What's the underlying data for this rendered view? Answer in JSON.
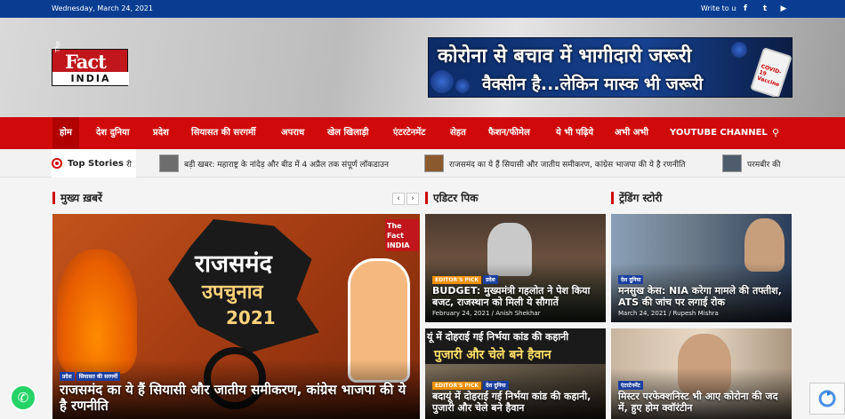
{
  "topbar": {
    "date": "Wednesday, March 24, 2021",
    "write_to_us": "Write to us",
    "social": [
      {
        "icon": "facebook-icon",
        "glyph": "f"
      },
      {
        "icon": "twitter-icon",
        "glyph": "t"
      },
      {
        "icon": "youtube-icon",
        "glyph": "▶"
      }
    ]
  },
  "logo": {
    "the": "The",
    "fact": "Fact",
    "india": "INDIA"
  },
  "banner": {
    "line1": "कोरोना से बचाव में भागीदारी जरूरी",
    "line2": "वैक्सीन है...लेकिन मास्क भी जरूरी",
    "vial_label": "COVID-19 Vaccine"
  },
  "nav": {
    "items": [
      "होम",
      "देश दुनिया",
      "प्रदेश",
      "सियासत की सरगर्मी",
      "अपराध",
      "खेल खिलाड़ी",
      "एंटरटेनमेंट",
      "सेहत",
      "फैशन/फीमेल",
      "ये भी पढ़िये",
      "अभी अभी",
      "YOUTUBE CHANNEL"
    ],
    "search_icon": "search-icon"
  },
  "ticker": {
    "label": "Top Stories",
    "items": [
      {
        "text": "री"
      },
      {
        "text": "बड़ी खबर: महाराष्ट्र के नांदेड़ और बीड में 4 अप्रैल तक संपूर्ण लॉकडाउन"
      },
      {
        "text": "राजसमंद का ये हैं सियासी और जातीय समीकरण, कांग्रेस भाजपा की ये है रणनीति"
      },
      {
        "text": "परमबीर की"
      }
    ]
  },
  "sections": {
    "main": "मुख्य ख़बरें",
    "editor": "एडिटर पिक",
    "trending": "ट्रेंडिंग स्टोरी"
  },
  "featured": {
    "badges": [
      "प्रदेश",
      "सियासत की सरगर्मी"
    ],
    "headline": "राजसमंद का ये हैं सियासी और जातीय समीकरण, कांग्रेस भाजपा की ये है रणनीति",
    "art_title": "राजसमंद",
    "art_subtitle": "उपचुनाव",
    "art_year": "2021",
    "watermark": "The Fact INDIA"
  },
  "editor_cards": [
    {
      "badges": [
        "EDITOR'S PICK",
        "प्रदेश"
      ],
      "headline": "BUDGET: मुख्यमंत्री गहलोत ने पेश किया बजट, राजस्थान को मिली ये सौगातें",
      "meta": "February 24, 2021 / Anish Shekhar"
    },
    {
      "art_line1": "यूं में दोहराई गई निर्भया कांड की कहानी",
      "art_line2": "पुजारी और चेले बने हैवान",
      "badges": [
        "EDITOR'S PICK",
        "देश दुनिया"
      ],
      "headline": "बदायूं में दोहराई गई निर्भया कांड की कहानी, पुजारी और चेले बने हैवान"
    }
  ],
  "trending_cards": [
    {
      "badges": [
        "देश दुनिया"
      ],
      "headline": "मनसुख केस: NIA करेगा मामले की तफ्तीश, ATS की जांच पर लगाई रोक",
      "meta": "March 24, 2021 / Rupesh Mishra"
    },
    {
      "badges": [
        "एंटरटेनमेंट"
      ],
      "headline": "मिस्टर परफेक्शनिस्ट भी आए कोरोना की जद में, हुए होम क्वॉरंटीन"
    }
  ],
  "colors": {
    "nav_red": "#d00a0a",
    "topbar_blue": "#0a3d91",
    "badge_orange": "#f29100",
    "badge_blue": "#1a3fa0"
  }
}
